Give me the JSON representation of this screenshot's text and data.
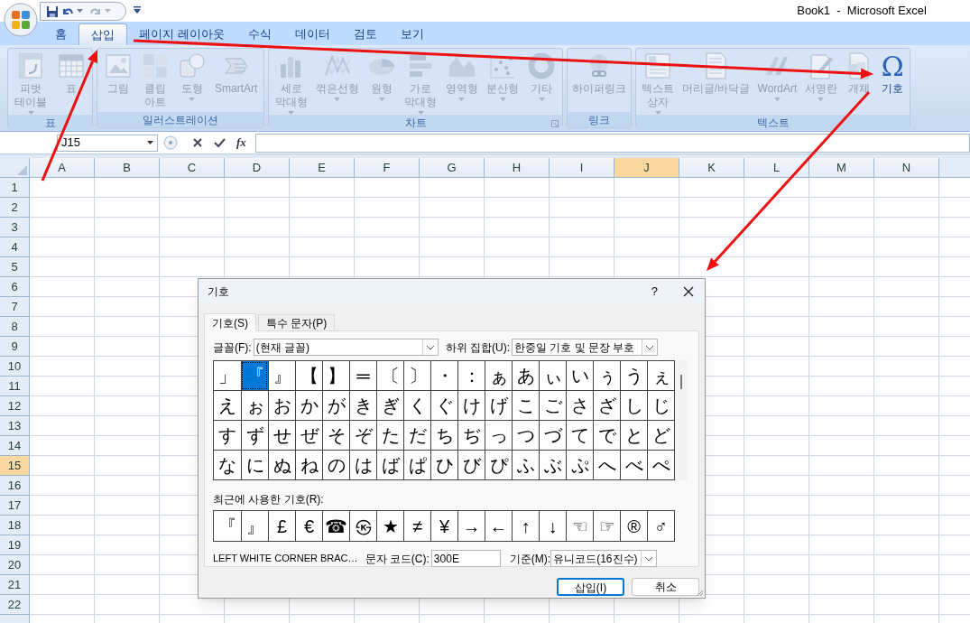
{
  "window": {
    "title": "Book1  -  Microsoft Excel"
  },
  "ribbon_tabs": [
    {
      "label": "홈",
      "selected": false
    },
    {
      "label": "삽입",
      "selected": true
    },
    {
      "label": "페이지 레이아웃",
      "selected": false
    },
    {
      "label": "수식",
      "selected": false
    },
    {
      "label": "데이터",
      "selected": false
    },
    {
      "label": "검토",
      "selected": false
    },
    {
      "label": "보기",
      "selected": false
    }
  ],
  "ribbon_groups": [
    {
      "label": "표",
      "launcher": false,
      "buttons": [
        {
          "label": "피벗\n테이블",
          "dropdown": true,
          "disabled": true
        },
        {
          "label": "표",
          "dropdown": false,
          "disabled": true
        }
      ]
    },
    {
      "label": "일러스트레이션",
      "launcher": false,
      "buttons": [
        {
          "label": "그림",
          "dropdown": false,
          "disabled": true
        },
        {
          "label": "클립\n아트",
          "dropdown": false,
          "disabled": true
        },
        {
          "label": "도형",
          "dropdown": true,
          "disabled": true
        },
        {
          "label": "SmartArt",
          "dropdown": false,
          "disabled": true
        }
      ]
    },
    {
      "label": "차트",
      "launcher": true,
      "buttons": [
        {
          "label": "세로\n막대형",
          "dropdown": true,
          "disabled": true
        },
        {
          "label": "꺾은선형",
          "dropdown": true,
          "disabled": true
        },
        {
          "label": "원형",
          "dropdown": true,
          "disabled": true
        },
        {
          "label": "가로\n막대형",
          "dropdown": true,
          "disabled": true
        },
        {
          "label": "영역형",
          "dropdown": true,
          "disabled": true
        },
        {
          "label": "분산형",
          "dropdown": true,
          "disabled": true
        },
        {
          "label": "기타",
          "dropdown": true,
          "disabled": true
        }
      ]
    },
    {
      "label": "링크",
      "launcher": false,
      "buttons": [
        {
          "label": "하이퍼링크",
          "dropdown": false,
          "disabled": true
        }
      ]
    },
    {
      "label": "텍스트",
      "launcher": false,
      "buttons": [
        {
          "label": "텍스트\n상자",
          "dropdown": true,
          "disabled": true
        },
        {
          "label": "머리글/바닥글",
          "dropdown": false,
          "disabled": true
        },
        {
          "label": "WordArt",
          "dropdown": true,
          "disabled": true
        },
        {
          "label": "서명란",
          "dropdown": true,
          "disabled": true
        },
        {
          "label": "개체",
          "dropdown": false,
          "disabled": true
        },
        {
          "label": "기호",
          "glyph": "Ω",
          "dropdown": false,
          "disabled": false
        }
      ]
    }
  ],
  "formula_bar": {
    "name_box": "J15",
    "fx": "fx"
  },
  "sheet": {
    "columns": [
      {
        "label": "A",
        "selected": false
      },
      {
        "label": "B",
        "selected": false
      },
      {
        "label": "C",
        "selected": false
      },
      {
        "label": "D",
        "selected": false
      },
      {
        "label": "E",
        "selected": false
      },
      {
        "label": "F",
        "selected": false
      },
      {
        "label": "G",
        "selected": false
      },
      {
        "label": "H",
        "selected": false
      },
      {
        "label": "I",
        "selected": false
      },
      {
        "label": "J",
        "selected": true
      },
      {
        "label": "K",
        "selected": false
      },
      {
        "label": "L",
        "selected": false
      },
      {
        "label": "M",
        "selected": false
      },
      {
        "label": "N",
        "selected": false
      }
    ],
    "rows": [
      {
        "label": "1",
        "selected": false
      },
      {
        "label": "2",
        "selected": false
      },
      {
        "label": "3",
        "selected": false
      },
      {
        "label": "4",
        "selected": false
      },
      {
        "label": "5",
        "selected": false
      },
      {
        "label": "6",
        "selected": false
      },
      {
        "label": "7",
        "selected": false
      },
      {
        "label": "8",
        "selected": false
      },
      {
        "label": "9",
        "selected": false
      },
      {
        "label": "10",
        "selected": false
      },
      {
        "label": "11",
        "selected": false
      },
      {
        "label": "12",
        "selected": false
      },
      {
        "label": "13",
        "selected": false
      },
      {
        "label": "14",
        "selected": false
      },
      {
        "label": "15",
        "selected": true
      },
      {
        "label": "16",
        "selected": false
      },
      {
        "label": "17",
        "selected": false
      },
      {
        "label": "18",
        "selected": false
      },
      {
        "label": "19",
        "selected": false
      },
      {
        "label": "20",
        "selected": false
      },
      {
        "label": "21",
        "selected": false
      },
      {
        "label": "22",
        "selected": false
      }
    ]
  },
  "dialog": {
    "title": "기호",
    "help": "?",
    "tabs": [
      {
        "label": "기호(S)",
        "selected": true
      },
      {
        "label": "특수 문자(P)",
        "selected": false
      }
    ],
    "font_label": "글꼴(F):",
    "font_value": "(현재 글꼴)",
    "subset_label": "하위 집합(U):",
    "subset_value": "한중일 기호 및 문장 부호",
    "symbols": [
      [
        {
          "c": "」",
          "selected": false
        },
        {
          "c": "『",
          "selected": true
        },
        {
          "c": "』",
          "selected": false
        },
        {
          "c": "【",
          "selected": false
        },
        {
          "c": "】",
          "selected": false
        },
        {
          "c": "═",
          "selected": false
        },
        {
          "c": "〔",
          "selected": false
        },
        {
          "c": "〕",
          "selected": false
        },
        {
          "c": "・",
          "selected": false
        },
        {
          "c": "：",
          "selected": false
        },
        {
          "c": "ぁ",
          "selected": false
        },
        {
          "c": "あ",
          "selected": false
        },
        {
          "c": "ぃ",
          "selected": false
        },
        {
          "c": "い",
          "selected": false
        },
        {
          "c": "ぅ",
          "selected": false
        },
        {
          "c": "う",
          "selected": false
        },
        {
          "c": "ぇ",
          "selected": false
        }
      ],
      [
        {
          "c": "え",
          "selected": false
        },
        {
          "c": "ぉ",
          "selected": false
        },
        {
          "c": "お",
          "selected": false
        },
        {
          "c": "か",
          "selected": false
        },
        {
          "c": "が",
          "selected": false
        },
        {
          "c": "き",
          "selected": false
        },
        {
          "c": "ぎ",
          "selected": false
        },
        {
          "c": "く",
          "selected": false
        },
        {
          "c": "ぐ",
          "selected": false
        },
        {
          "c": "け",
          "selected": false
        },
        {
          "c": "げ",
          "selected": false
        },
        {
          "c": "こ",
          "selected": false
        },
        {
          "c": "ご",
          "selected": false
        },
        {
          "c": "さ",
          "selected": false
        },
        {
          "c": "ざ",
          "selected": false
        },
        {
          "c": "し",
          "selected": false
        },
        {
          "c": "じ",
          "selected": false
        }
      ],
      [
        {
          "c": "す",
          "selected": false
        },
        {
          "c": "ず",
          "selected": false
        },
        {
          "c": "せ",
          "selected": false
        },
        {
          "c": "ぜ",
          "selected": false
        },
        {
          "c": "そ",
          "selected": false
        },
        {
          "c": "ぞ",
          "selected": false
        },
        {
          "c": "た",
          "selected": false
        },
        {
          "c": "だ",
          "selected": false
        },
        {
          "c": "ち",
          "selected": false
        },
        {
          "c": "ぢ",
          "selected": false
        },
        {
          "c": "っ",
          "selected": false
        },
        {
          "c": "つ",
          "selected": false
        },
        {
          "c": "づ",
          "selected": false
        },
        {
          "c": "て",
          "selected": false
        },
        {
          "c": "で",
          "selected": false
        },
        {
          "c": "と",
          "selected": false
        },
        {
          "c": "ど",
          "selected": false
        }
      ],
      [
        {
          "c": "な",
          "selected": false
        },
        {
          "c": "に",
          "selected": false
        },
        {
          "c": "ぬ",
          "selected": false
        },
        {
          "c": "ね",
          "selected": false
        },
        {
          "c": "の",
          "selected": false
        },
        {
          "c": "は",
          "selected": false
        },
        {
          "c": "ば",
          "selected": false
        },
        {
          "c": "ぱ",
          "selected": false
        },
        {
          "c": "ひ",
          "selected": false
        },
        {
          "c": "び",
          "selected": false
        },
        {
          "c": "ぴ",
          "selected": false
        },
        {
          "c": "ふ",
          "selected": false
        },
        {
          "c": "ぶ",
          "selected": false
        },
        {
          "c": "ぷ",
          "selected": false
        },
        {
          "c": "へ",
          "selected": false
        },
        {
          "c": "べ",
          "selected": false
        },
        {
          "c": "ぺ",
          "selected": false
        }
      ]
    ],
    "recent_label": "최근에 사용한 기호(R):",
    "recent": [
      "『",
      "』",
      "£",
      "€",
      "☎",
      "㉿",
      "★",
      "≠",
      "¥",
      "→",
      "←",
      "↑",
      "↓",
      "☜",
      "☞",
      "®",
      "♂"
    ],
    "char_name": "LEFT WHITE CORNER BRAC…",
    "code_label": "문자 코드(C):",
    "code_value": "300E",
    "from_label": "기준(M):",
    "from_value": "유니코드(16진수)",
    "buttons": [
      {
        "label": "삽입(I)",
        "default": true
      },
      {
        "label": "취소",
        "default": false
      }
    ]
  }
}
